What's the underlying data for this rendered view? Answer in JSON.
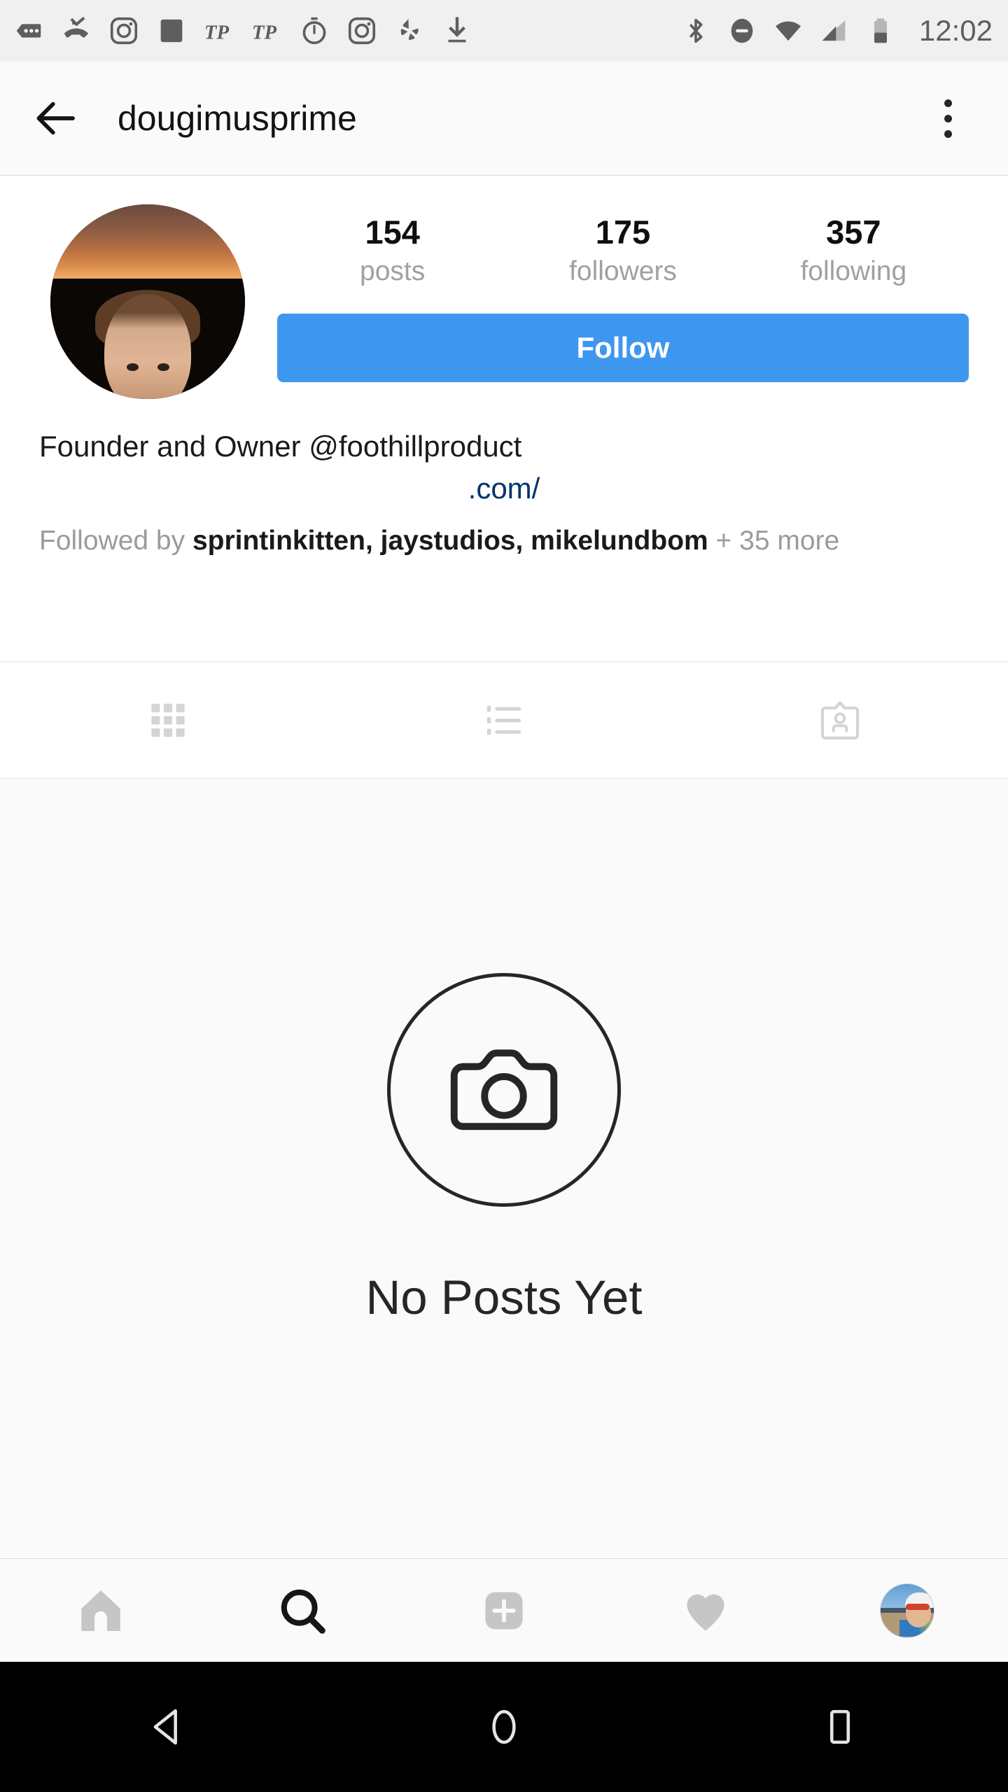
{
  "status_bar": {
    "time": "12:02",
    "left_icons": [
      "more-notifications-icon",
      "missed-call-icon",
      "instagram-icon",
      "app-square-icon",
      "tp-italic-icon",
      "tp-italic-icon-2",
      "stopwatch-icon",
      "instagram-icon-2",
      "yelp-icon",
      "download-icon"
    ],
    "right_icons": [
      "bluetooth-icon",
      "do-not-disturb-icon",
      "wifi-icon",
      "cellular-signal-icon",
      "battery-icon"
    ]
  },
  "header": {
    "title": "dougimusprime",
    "back_icon": "back-arrow-icon",
    "overflow_icon": "overflow-menu-icon"
  },
  "profile": {
    "avatar_alt": "dougimusprime profile photo",
    "stats": [
      {
        "value": "154",
        "label": "posts"
      },
      {
        "value": "175",
        "label": "followers"
      },
      {
        "value": "357",
        "label": "following"
      }
    ],
    "follow_button": "Follow",
    "bio": "Founder and Owner @foothillproduct",
    "website": ".com/",
    "followed_by_prefix": "Followed by ",
    "followed_by_names": "sprintinkitten, jaystudios, mikelundbom",
    "followed_by_suffix": " + 35 more"
  },
  "tabs": [
    {
      "name": "grid-tab",
      "icon": "grid-icon",
      "active": false
    },
    {
      "name": "list-tab",
      "icon": "list-icon",
      "active": false
    },
    {
      "name": "tagged-tab",
      "icon": "tagged-person-icon",
      "active": false
    }
  ],
  "empty_state": {
    "icon": "camera-icon",
    "text": "No Posts Yet"
  },
  "bottom_nav": [
    {
      "name": "home-tab",
      "icon": "home-icon",
      "active": false
    },
    {
      "name": "search-tab",
      "icon": "search-icon",
      "active": true
    },
    {
      "name": "add-post-tab",
      "icon": "plus-square-icon",
      "active": false
    },
    {
      "name": "activity-tab",
      "icon": "heart-icon",
      "active": false
    },
    {
      "name": "profile-tab",
      "icon": "avatar-icon",
      "active": false
    }
  ],
  "android_nav": [
    {
      "name": "back-button",
      "icon": "triangle-back-icon"
    },
    {
      "name": "home-button",
      "icon": "circle-home-icon"
    },
    {
      "name": "recents-button",
      "icon": "square-recents-icon"
    }
  ],
  "colors": {
    "follow_blue": "#3e97ef",
    "link_navy": "#003569",
    "status_bg": "#eff0ef",
    "empty_bg": "#fafafa",
    "text_primary": "#262626",
    "text_muted": "#a0a0a0"
  }
}
